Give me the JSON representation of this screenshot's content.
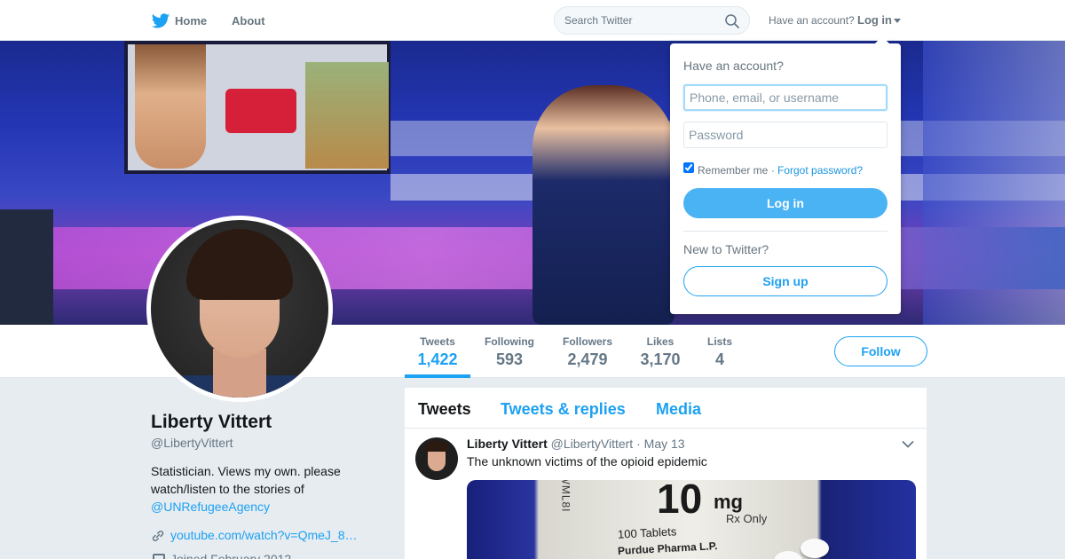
{
  "nav": {
    "home_label": "Home",
    "about_label": "About",
    "search_placeholder": "Search Twitter",
    "have_account": "Have an account?",
    "login_label": "Log in"
  },
  "login_dropdown": {
    "title": "Have an account?",
    "username_placeholder": "Phone, email, or username",
    "password_placeholder": "Password",
    "remember_label": "Remember me",
    "separator": "·",
    "forgot_label": "Forgot password?",
    "login_button": "Log in",
    "new_prompt": "New to Twitter?",
    "signup_button": "Sign up"
  },
  "stats": [
    {
      "label": "Tweets",
      "value": "1,422"
    },
    {
      "label": "Following",
      "value": "593"
    },
    {
      "label": "Followers",
      "value": "2,479"
    },
    {
      "label": "Likes",
      "value": "3,170"
    },
    {
      "label": "Lists",
      "value": "4"
    }
  ],
  "follow_button": "Follow",
  "profile": {
    "name": "Liberty Vittert",
    "handle": "@LibertyVittert",
    "bio_text": "Statistician. Views my own. please watch/listen to the stories of",
    "bio_link": "@UNRefugeeAgency",
    "website": "youtube.com/watch?v=QmeJ_8…",
    "joined": "Joined February 2012"
  },
  "timeline": {
    "tabs": [
      "Tweets",
      "Tweets & replies",
      "Media"
    ]
  },
  "tweet": {
    "author": "Liberty Vittert",
    "handle": "@LibertyVittert",
    "separator": "·",
    "date": "May 13",
    "text": "The unknown victims of the opioid epidemic",
    "media_text": {
      "dose": "10",
      "unit": "mg",
      "rx": "Rx Only",
      "tablets": "100 Tablets",
      "maker": "Purdue Pharma L.P.",
      "side": "WML8I"
    }
  },
  "colors": {
    "brand": "#1da1f2",
    "login_button": "#4ab3f4",
    "text_primary": "#14171a",
    "text_secondary": "#657786",
    "page_bg": "#e6ecf0"
  }
}
